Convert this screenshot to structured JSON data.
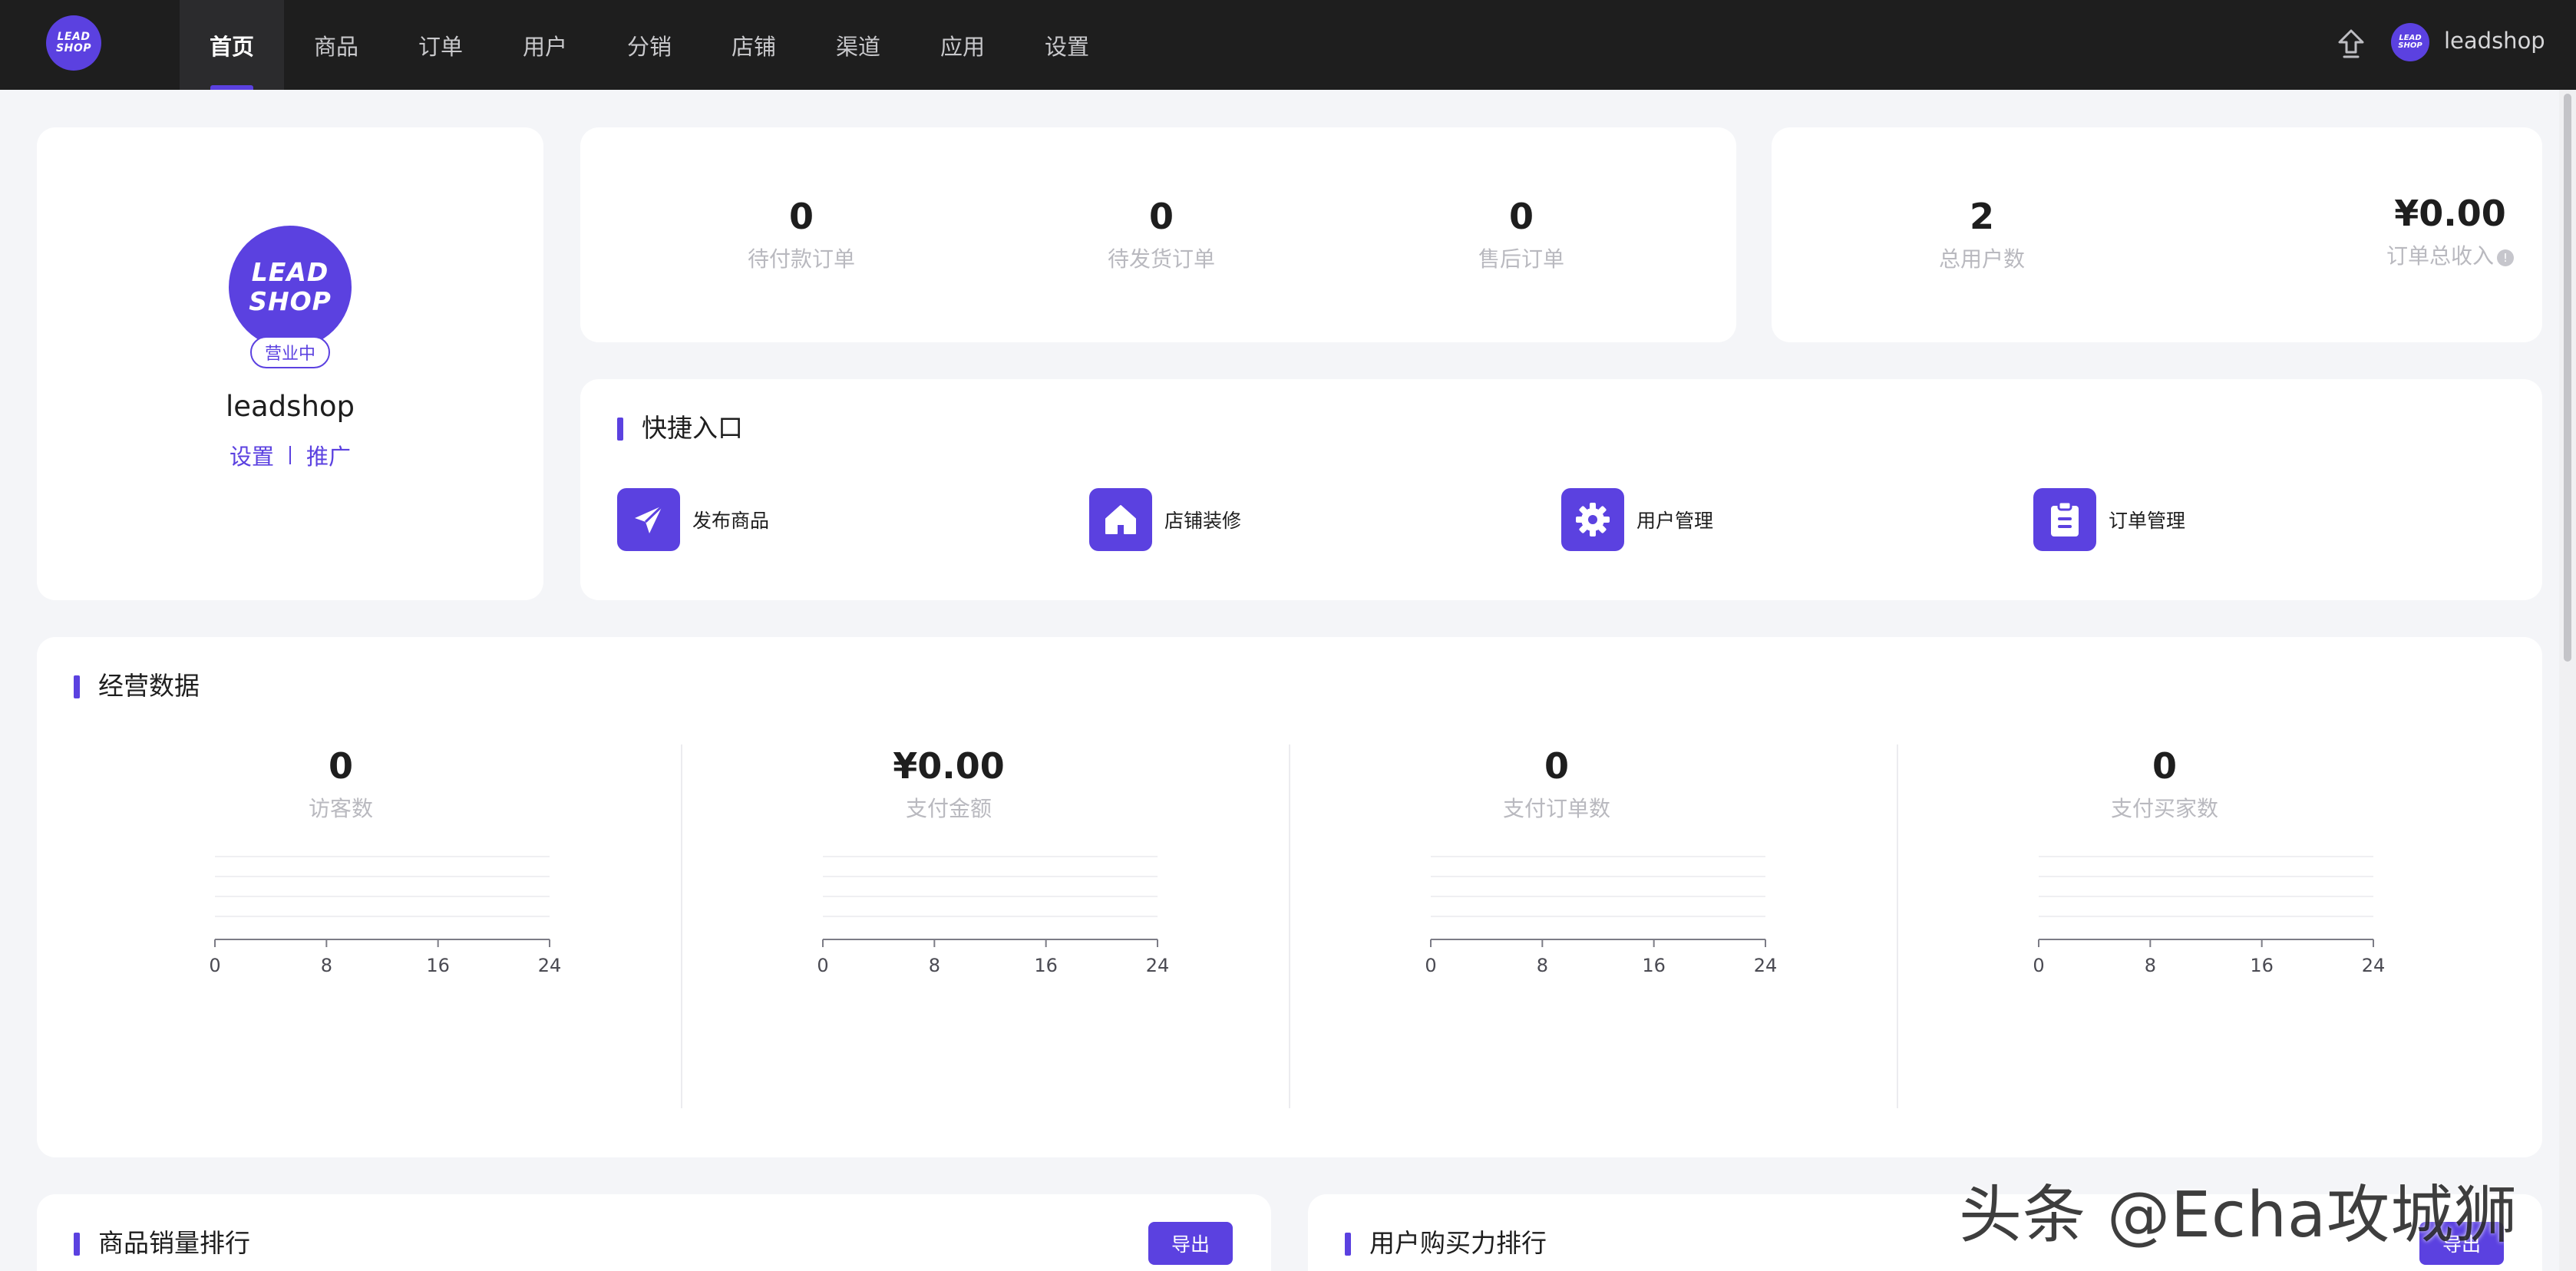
{
  "header": {
    "logo_line1": "LEAD",
    "logo_line2": "SHOP",
    "nav": [
      "首页",
      "商品",
      "订单",
      "用户",
      "分销",
      "店铺",
      "渠道",
      "应用",
      "设置"
    ],
    "active_index": 0,
    "user_name": "leadshop",
    "upload_icon": "upload-icon"
  },
  "shop": {
    "logo_line1": "LEAD",
    "logo_line2": "SHOP",
    "status": "营业中",
    "name": "leadshop",
    "settings_link": "设置",
    "promote_link": "推广"
  },
  "orders": [
    {
      "value": "0",
      "label": "待付款订单"
    },
    {
      "value": "0",
      "label": "待发货订单"
    },
    {
      "value": "0",
      "label": "售后订单"
    }
  ],
  "users": [
    {
      "value": "2",
      "label": "总用户数"
    },
    {
      "value": "¥0.00",
      "label": "订单总收入",
      "info_icon": "info-icon"
    }
  ],
  "quick": {
    "title": "快捷入口",
    "items": [
      {
        "label": "发布商品",
        "icon": "paper-plane-icon"
      },
      {
        "label": "店铺装修",
        "icon": "home-icon"
      },
      {
        "label": "用户管理",
        "icon": "gear-icon"
      },
      {
        "label": "订单管理",
        "icon": "clipboard-icon"
      }
    ]
  },
  "business": {
    "title": "经营数据",
    "metrics": [
      {
        "value": "0",
        "label": "访客数"
      },
      {
        "value": "¥0.00",
        "label": "支付金额"
      },
      {
        "value": "0",
        "label": "支付订单数"
      },
      {
        "value": "0",
        "label": "支付买家数"
      }
    ]
  },
  "chart_data": [
    {
      "type": "line",
      "x_ticks": [
        "0",
        "8",
        "16",
        "24"
      ],
      "xlim": [
        0,
        24
      ],
      "series": [],
      "grid": true
    },
    {
      "type": "line",
      "x_ticks": [
        "0",
        "8",
        "16",
        "24"
      ],
      "xlim": [
        0,
        24
      ],
      "series": [],
      "grid": true
    },
    {
      "type": "line",
      "x_ticks": [
        "0",
        "8",
        "16",
        "24"
      ],
      "xlim": [
        0,
        24
      ],
      "series": [],
      "grid": true
    },
    {
      "type": "line",
      "x_ticks": [
        "0",
        "8",
        "16",
        "24"
      ],
      "xlim": [
        0,
        24
      ],
      "series": [],
      "grid": true
    }
  ],
  "rankings": {
    "product_title": "商品销量排行",
    "user_title": "用户购买力排行",
    "export_label": "导出"
  },
  "watermark": "头条 @Echa攻城狮",
  "colors": {
    "accent": "#5b41e0",
    "topbar": "#1e1e1e",
    "page_bg": "#f4f5f8"
  }
}
